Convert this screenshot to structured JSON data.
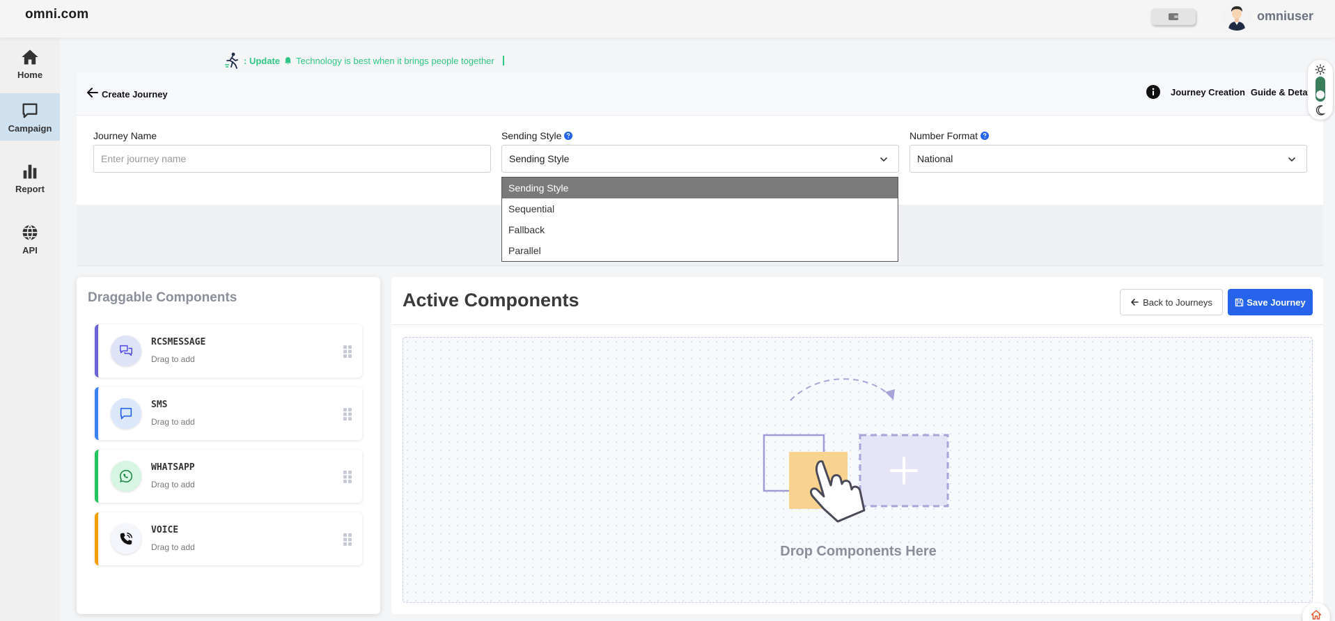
{
  "header": {
    "logo": "omni.com",
    "username": "omniuser"
  },
  "sidebar": {
    "items": [
      {
        "label": "Home",
        "icon": "home-icon"
      },
      {
        "label": "Campaign",
        "icon": "chat-icon",
        "active": true
      },
      {
        "label": "Report",
        "icon": "bar-chart-icon"
      },
      {
        "label": "API",
        "icon": "globe-icon"
      }
    ]
  },
  "ticker": {
    "prefix": ": Update",
    "message": "Technology is best when it brings people together"
  },
  "journey_bar": {
    "title": "Create Journey",
    "guide_part1": "Journey Creation",
    "guide_part2": "Guide & Details"
  },
  "form": {
    "journey_name_label": "Journey Name",
    "journey_name_placeholder": "Enter journey name",
    "journey_name_value": "",
    "sending_style_label": "Sending Style",
    "sending_style_value": "Sending Style",
    "sending_style_options": [
      "Sending Style",
      "Sequential",
      "Fallback",
      "Parallel"
    ],
    "number_format_label": "Number Format",
    "number_format_value": "National"
  },
  "draggable": {
    "title": "Draggable Components",
    "components": [
      {
        "name": "RCSMESSAGE",
        "sub": "Drag to add",
        "accent": "#6b63d9",
        "icon": "chat-bubbles-icon"
      },
      {
        "name": "SMS",
        "sub": "Drag to add",
        "accent": "#3b82f6",
        "icon": "message-square-icon"
      },
      {
        "name": "WHATSAPP",
        "sub": "Drag to add",
        "accent": "#22c55e",
        "icon": "whatsapp-icon"
      },
      {
        "name": "VOICE",
        "sub": "Drag to add",
        "accent": "#f59e0b",
        "icon": "phone-icon"
      }
    ]
  },
  "active": {
    "title": "Active Components",
    "back_label": "Back to Journeys",
    "save_label": "Save Journey",
    "drop_text": "Drop Components Here"
  },
  "colors": {
    "primary": "#2563eb",
    "ticker": "#2fc786",
    "sidebar_active": "#cfe0ef"
  }
}
